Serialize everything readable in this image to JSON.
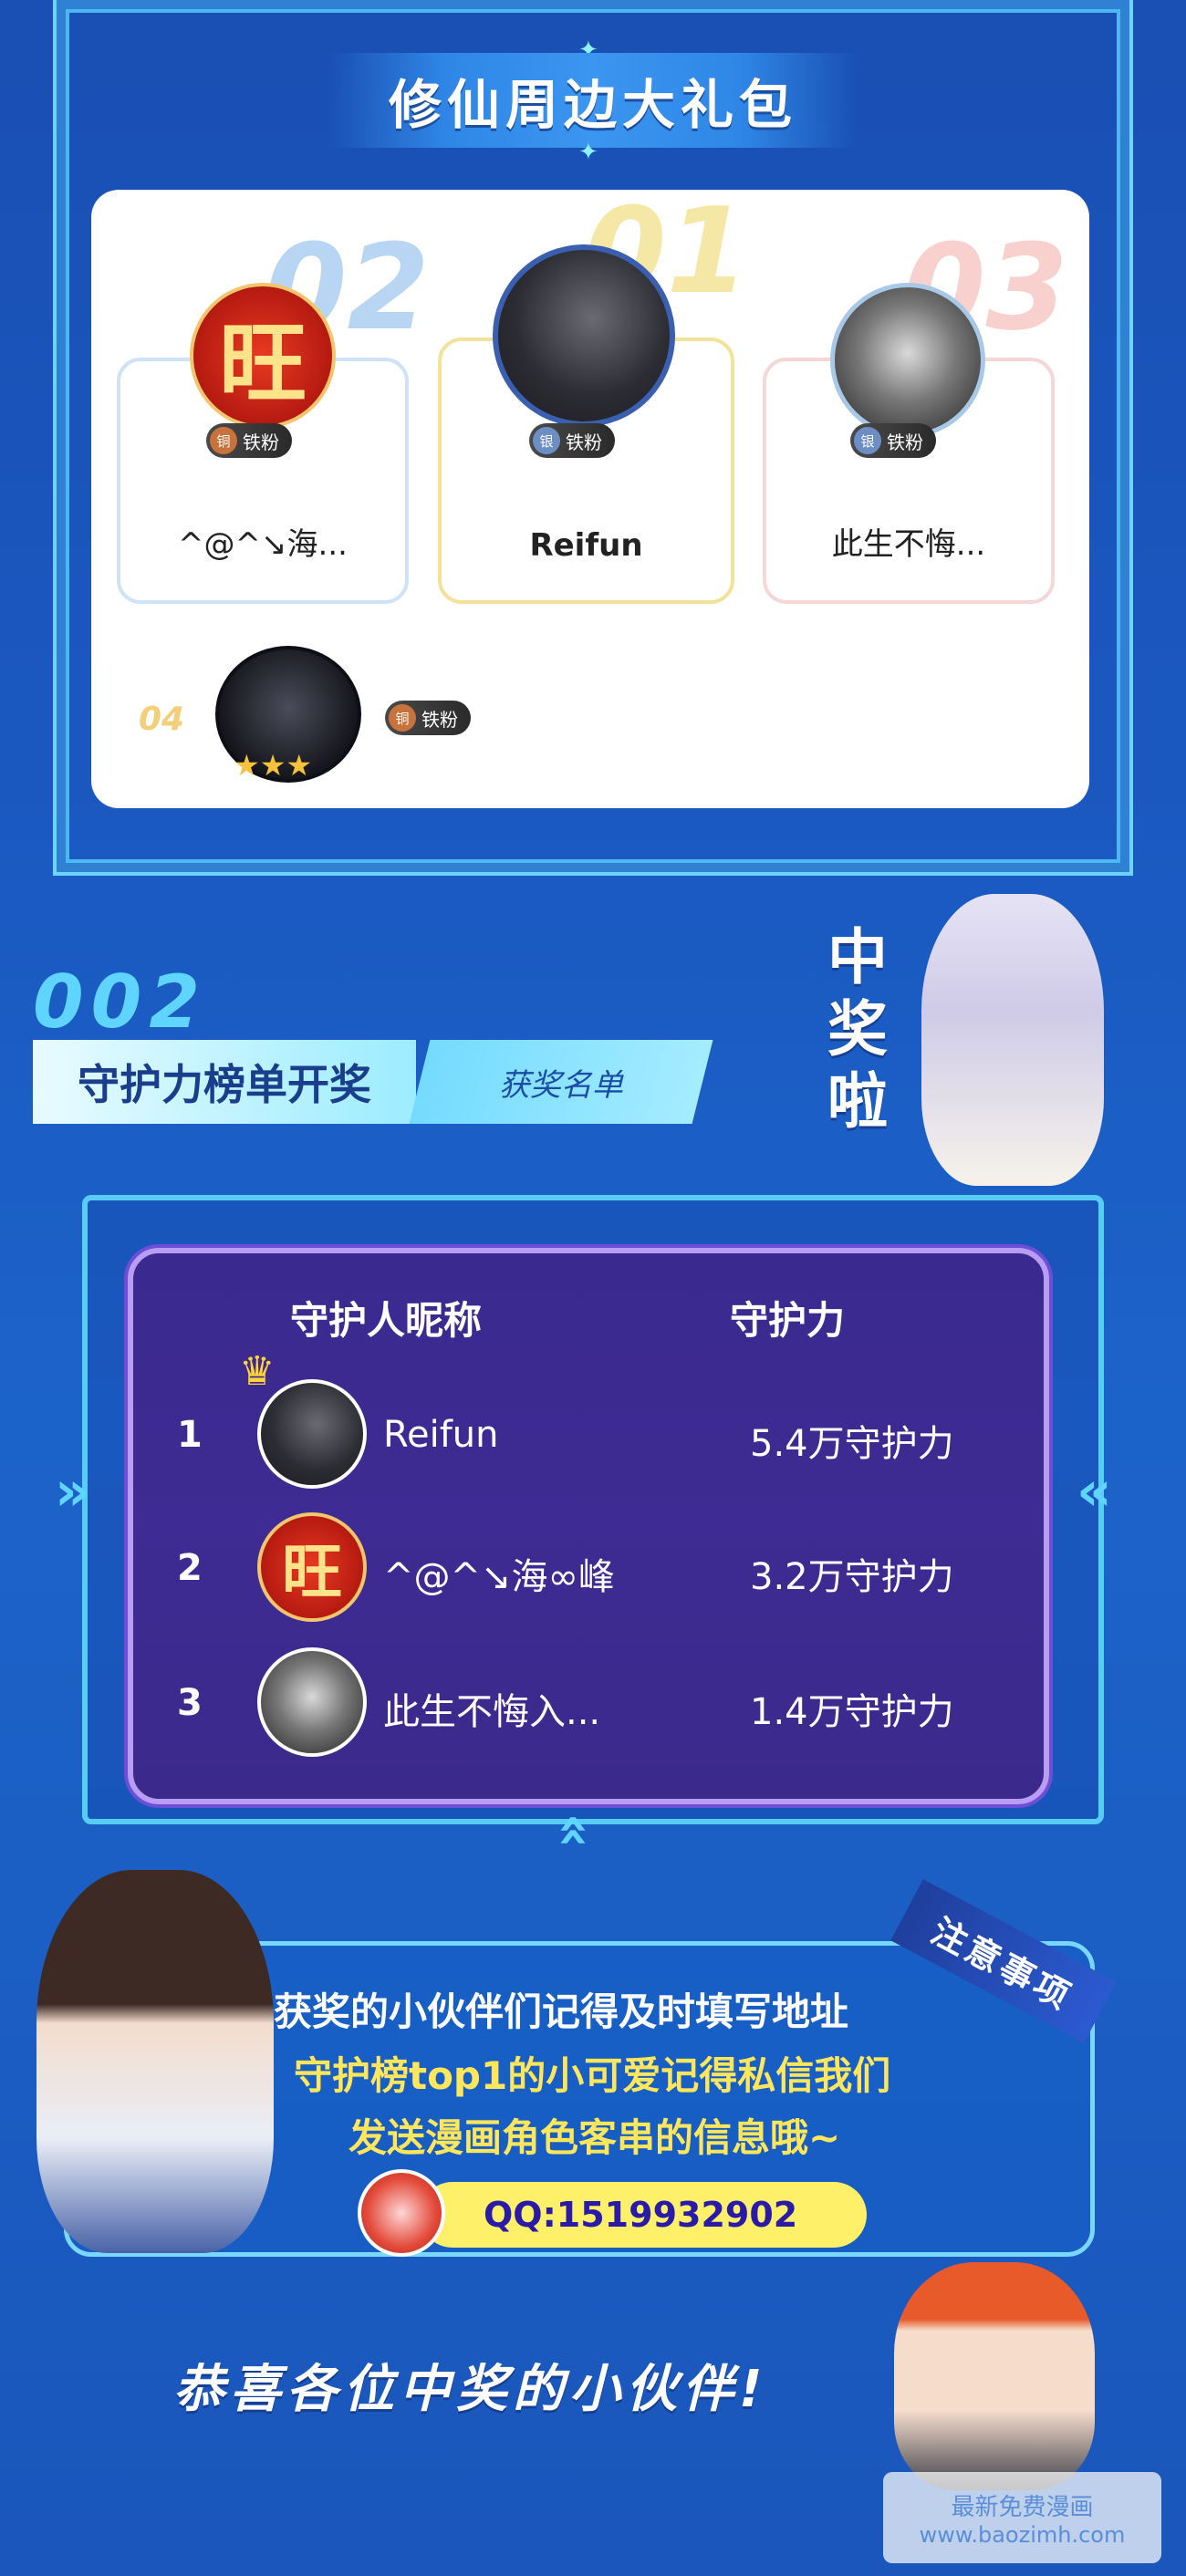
{
  "gift_section": {
    "title": "修仙周边大礼包",
    "ranks": [
      {
        "number": "02",
        "name": "^@^↘海...",
        "badge": "铁粉",
        "medal": "铜"
      },
      {
        "number": "01",
        "name": "Reifun",
        "badge": "铁粉",
        "medal": "银"
      },
      {
        "number": "03",
        "name": "此生不悔...",
        "badge": "铁粉",
        "medal": "银"
      },
      {
        "number": "04",
        "name": "",
        "badge": "铁粉",
        "medal": "铜"
      }
    ],
    "wang_char": "旺"
  },
  "guard_section": {
    "section_number": "002",
    "title": "守护力榜单开奖",
    "tag": "获奖名单",
    "winner_text": [
      "中",
      "奖",
      "啦"
    ],
    "table": {
      "headers": [
        "守护人昵称",
        "守护力"
      ],
      "rows": [
        {
          "rank": "1",
          "name": "Reifun",
          "power": "5.4万守护力"
        },
        {
          "rank": "2",
          "name": "^@^↘海∞峰",
          "power": "3.2万守护力"
        },
        {
          "rank": "3",
          "name": "此生不悔入...",
          "power": "1.4万守护力"
        }
      ]
    }
  },
  "notice": {
    "tag": "注意事项",
    "line1": "获奖的小伙伴们记得及时填写地址",
    "line2": "守护榜top1的小可爱记得私信我们",
    "line3": "发送漫画角色客串的信息哦~",
    "qq": "QQ:1519932902"
  },
  "footer": {
    "congrats": "恭喜各位中奖的小伙伴!",
    "watermark_line1": "最新免费漫画",
    "watermark_line2": "www.baozimh.com"
  },
  "colors": {
    "background": "#1a58c0",
    "accent_cyan": "#5fd4ff",
    "board_purple": "#3e2b93",
    "highlight_yellow": "#ffe65a"
  }
}
